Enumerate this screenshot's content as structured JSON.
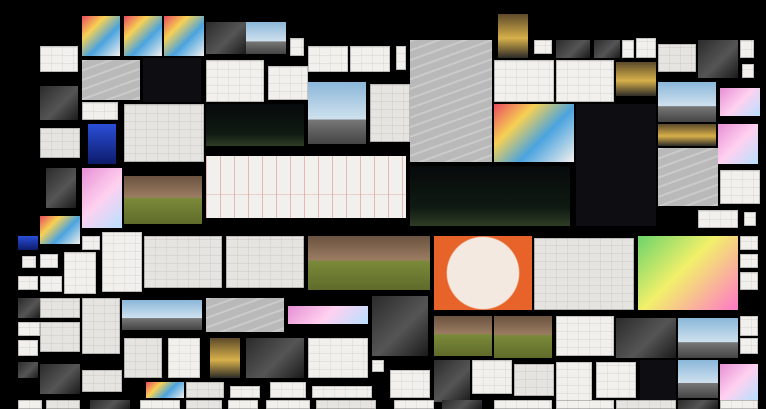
{
  "board": {
    "background": "#000000",
    "thumbnail_count": 0
  },
  "tile_palette": {
    "paper": "#f2f0ec",
    "sketch": "#e6e4e0",
    "ink": "#1a1a1a",
    "orange_frame": "#e8632a",
    "rose_line": "#d98a86",
    "sky": "#8bb7d9",
    "grass": "#7c8a3a",
    "dusk": "#6b5340",
    "grey_model": "#b9b9b9",
    "night": "#0e0e12",
    "pink": "#e68fd3",
    "gold": "#d7b04a",
    "green_plan": "#6bd46a",
    "blue_ui": "#2a4fd8"
  }
}
